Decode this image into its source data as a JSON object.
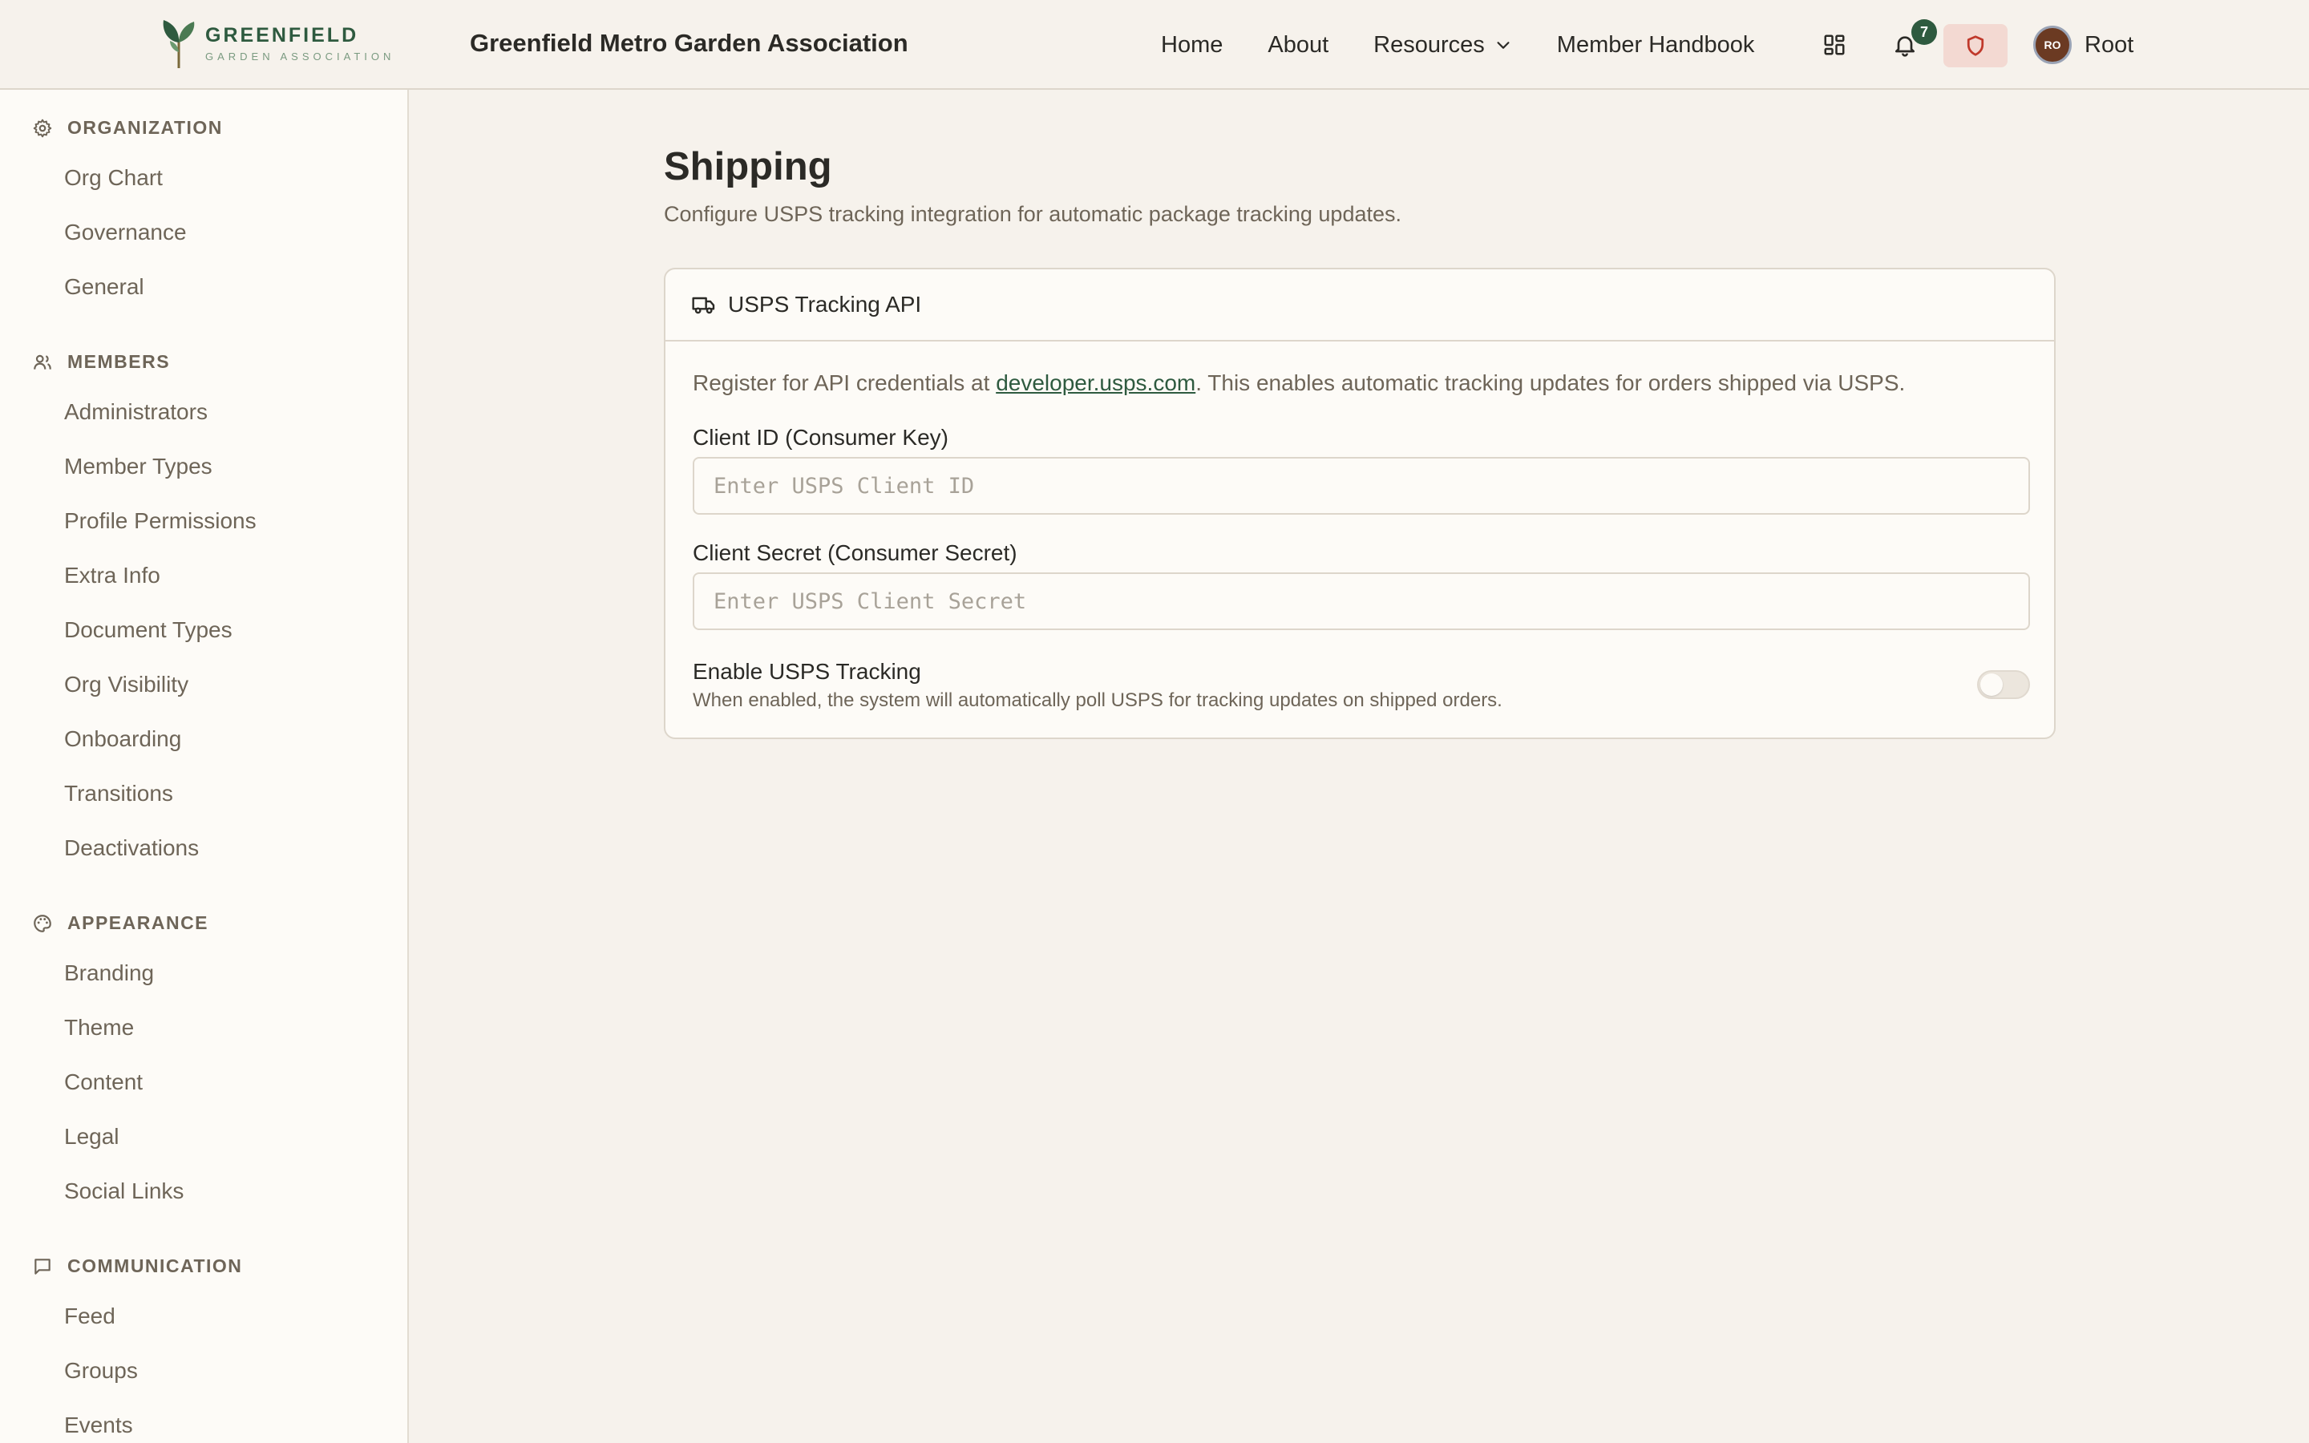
{
  "header": {
    "logo_main": "GREENFIELD",
    "logo_sub": "GARDEN ASSOCIATION",
    "site_title": "Greenfield Metro Garden Association",
    "nav": [
      {
        "label": "Home"
      },
      {
        "label": "About"
      },
      {
        "label": "Resources"
      },
      {
        "label": "Member Handbook"
      }
    ],
    "notification_count": "7",
    "user": {
      "initials": "RO",
      "name": "Root"
    }
  },
  "sidebar": {
    "sections": [
      {
        "title": "ORGANIZATION",
        "icon": "gear-icon",
        "items": [
          "Org Chart",
          "Governance",
          "General"
        ]
      },
      {
        "title": "MEMBERS",
        "icon": "users-icon",
        "items": [
          "Administrators",
          "Member Types",
          "Profile Permissions",
          "Extra Info",
          "Document Types",
          "Org Visibility",
          "Onboarding",
          "Transitions",
          "Deactivations"
        ]
      },
      {
        "title": "APPEARANCE",
        "icon": "palette-icon",
        "items": [
          "Branding",
          "Theme",
          "Content",
          "Legal",
          "Social Links"
        ]
      },
      {
        "title": "COMMUNICATION",
        "icon": "message-icon",
        "items": [
          "Feed",
          "Groups",
          "Events"
        ]
      }
    ]
  },
  "main": {
    "title": "Shipping",
    "description": "Configure USPS tracking integration for automatic package tracking updates.",
    "card": {
      "title": "USPS Tracking API",
      "note_prefix": "Register for API credentials at ",
      "note_link": "developer.usps.com",
      "note_suffix": ". This enables automatic tracking updates for orders shipped via USPS.",
      "client_id_label": "Client ID (Consumer Key)",
      "client_id_placeholder": "Enter USPS Client ID",
      "client_id_value": "",
      "client_secret_label": "Client Secret (Consumer Secret)",
      "client_secret_placeholder": "Enter USPS Client Secret",
      "client_secret_value": "",
      "toggle_label": "Enable USPS Tracking",
      "toggle_description": "When enabled, the system will automatically poll USPS for tracking updates on shipped orders.",
      "toggle_enabled": false
    }
  },
  "colors": {
    "brand_green": "#2e5a3f",
    "background": "#f6f2ec",
    "sidebar_bg": "#fdfbf7",
    "alert_bg": "#f3d9d2",
    "alert_icon": "#c0392b"
  }
}
